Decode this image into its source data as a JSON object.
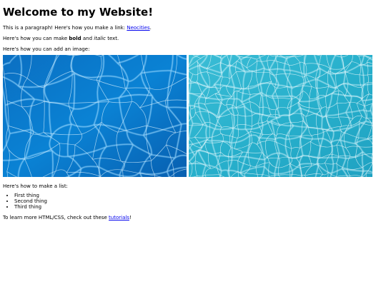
{
  "heading": "Welcome to my Website!",
  "paragraph1": {
    "prefix": "This is a paragraph! Here's how you make a link: ",
    "link_text": "Neocities",
    "suffix": "."
  },
  "paragraph2": {
    "prefix": "Here's how you can make ",
    "bold": "bold",
    "middle": " and ",
    "italic": "italic",
    "suffix": " text."
  },
  "paragraph3": "Here's how you can add an image:",
  "images": [
    {
      "name": "pool-water-image-deep",
      "colors": {
        "base": "#0a78cc",
        "dark": "#0757a5",
        "light": "#8fd4fb"
      }
    },
    {
      "name": "pool-water-image-light",
      "colors": {
        "base": "#2cb4cf",
        "dark": "#1b97b8",
        "light": "#d9f5fb"
      }
    }
  ],
  "paragraph4": "Here's how to make a list:",
  "list": [
    "First thing",
    "Second thing",
    "Third thing"
  ],
  "paragraph5": {
    "prefix": "To learn more HTML/CSS, check out these ",
    "link_text": "tutorials",
    "suffix": "!"
  }
}
